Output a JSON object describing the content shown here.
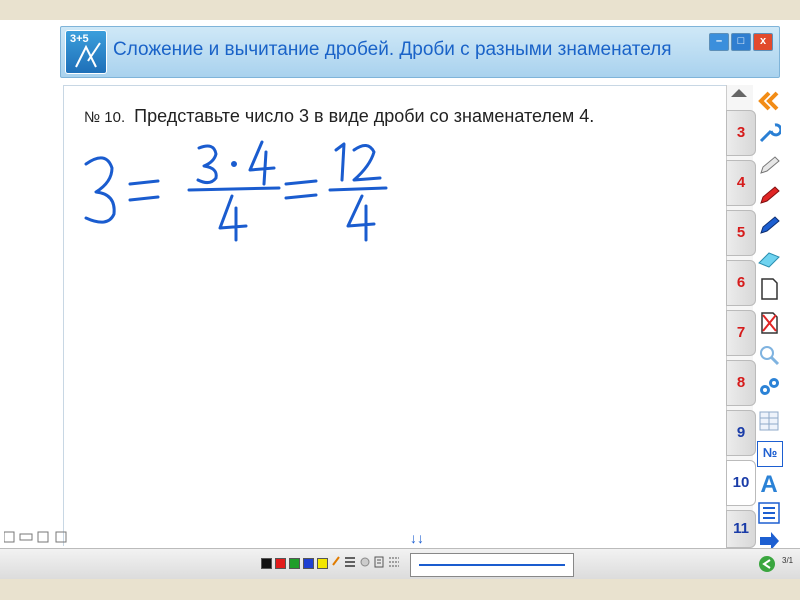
{
  "window": {
    "title": "Сложение и вычитание дробей. Дроби с разными знаменателя",
    "app_icon_text": "3+5",
    "buttons": {
      "minimize": "–",
      "maximize": "□",
      "close": "x"
    }
  },
  "task": {
    "number": "№ 10.",
    "text": "Представьте число 3 в виде дроби со знаменателем 4."
  },
  "handwriting": {
    "whole": "3",
    "numerator1": "3 · 4",
    "denominator1": "4",
    "numerator2": "12",
    "denominator2": "4"
  },
  "page_tabs": [
    {
      "label": "3",
      "color": "red"
    },
    {
      "label": "4",
      "color": "red"
    },
    {
      "label": "5",
      "color": "red"
    },
    {
      "label": "6",
      "color": "red"
    },
    {
      "label": "7",
      "color": "red"
    },
    {
      "label": "8",
      "color": "red"
    },
    {
      "label": "9",
      "color": "blue"
    },
    {
      "label": "10",
      "color": "blue",
      "active": true
    },
    {
      "label": "11",
      "color": "blue"
    }
  ],
  "tools": [
    "double-chevron-left-icon",
    "wrench-icon",
    "pencil-icon",
    "red-marker-icon",
    "blue-marker-icon",
    "eraser-icon",
    "blank-page-icon",
    "delete-page-icon",
    "zoom-icon",
    "gears-icon",
    "table-icon",
    "number-sign-icon",
    "text-a-icon",
    "list-icon",
    "arrow-right-icon"
  ],
  "tool_labels": {
    "number_sign": "№",
    "text_a": "A"
  },
  "palette": [
    "#111111",
    "#e21b1b",
    "#1f9e2a",
    "#1d3fd1",
    "#f2e600"
  ],
  "pen_color": "#1a5ccf",
  "pagination": "3/1",
  "down_arrows": "↓↓"
}
